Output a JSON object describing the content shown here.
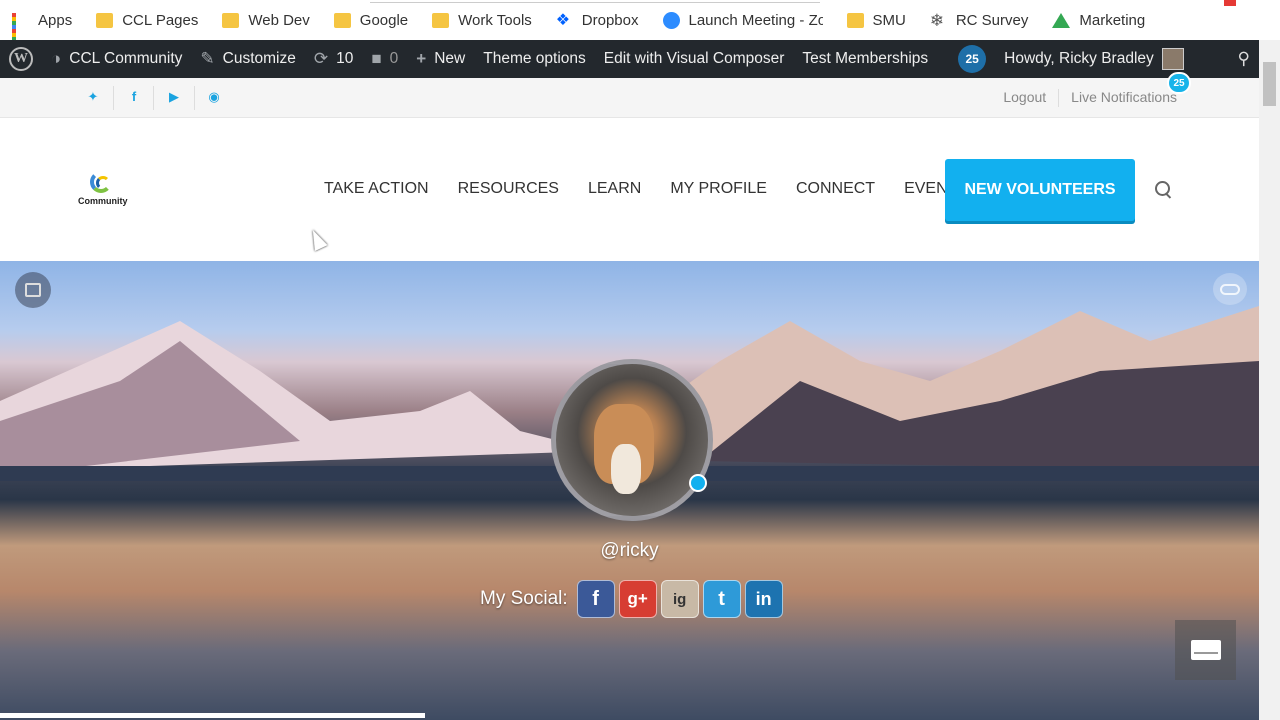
{
  "bookmarks": [
    {
      "label": "Apps",
      "icon": "apps-grid-icon"
    },
    {
      "label": "CCL Pages",
      "icon": "folder-icon"
    },
    {
      "label": "Web Dev",
      "icon": "folder-icon"
    },
    {
      "label": "Google",
      "icon": "folder-icon"
    },
    {
      "label": "Work Tools",
      "icon": "folder-icon"
    },
    {
      "label": "Dropbox",
      "icon": "dropbox-icon"
    },
    {
      "label": "Launch Meeting - Zo",
      "icon": "zoom-icon"
    },
    {
      "label": "SMU",
      "icon": "folder-icon"
    },
    {
      "label": "RC Survey",
      "icon": "rc-survey-icon"
    },
    {
      "label": "Marketing",
      "icon": "google-drive-icon"
    }
  ],
  "adminbar": {
    "site": "CCL Community",
    "customize": "Customize",
    "updates": "10",
    "comments": "0",
    "new": "New",
    "theme_options": "Theme options",
    "visual_composer": "Edit with Visual Composer",
    "test_memberships": "Test Memberships",
    "notif_count": "25",
    "howdy": "Howdy, Ricky Bradley"
  },
  "topbar": {
    "logout": "Logout",
    "live_notifications": "Live Notifications",
    "notif_badge": "25"
  },
  "header": {
    "logo_text": "Community",
    "nav": [
      "TAKE ACTION",
      "RESOURCES",
      "LEARN",
      "MY PROFILE",
      "CONNECT",
      "EVENTS"
    ],
    "cta": "NEW VOLUNTEERS"
  },
  "profile": {
    "handle": "@ricky",
    "social_label": "My Social:",
    "social_buttons": [
      "f",
      "g+",
      "ig",
      "t",
      "in"
    ]
  },
  "colors": {
    "accent": "#12b0ef",
    "adminbar": "#23282d"
  }
}
